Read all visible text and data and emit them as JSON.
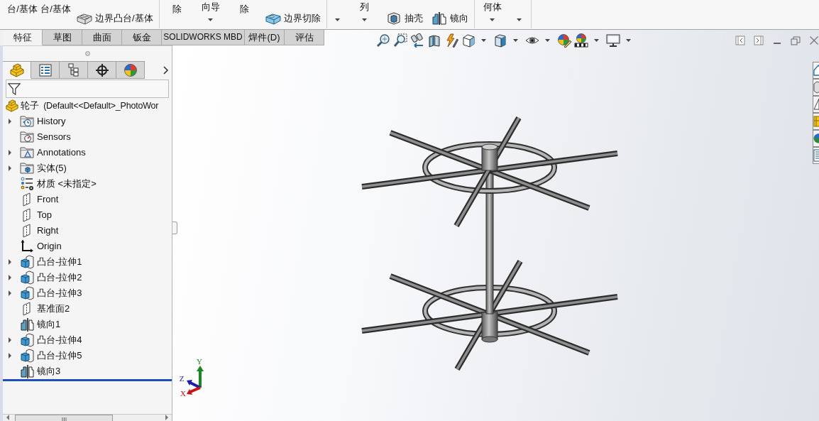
{
  "ribbon": {
    "groups": [
      {
        "items": [
          {
            "kind": "tall",
            "label": "台/基体"
          },
          {
            "kind": "tall",
            "label": "台/基体"
          },
          {
            "kind": "small",
            "label": "边界凸台/基体"
          }
        ]
      },
      {
        "items": [
          {
            "kind": "tall",
            "label": "除"
          },
          {
            "kind": "menu",
            "label": "向导"
          },
          {
            "kind": "tall",
            "label": "除"
          },
          {
            "kind": "small",
            "label": "边界切除"
          }
        ]
      },
      {
        "items": [
          {
            "kind": "caret"
          },
          {
            "kind": "menu",
            "label": "列"
          },
          {
            "kind": "small",
            "label": "抽壳"
          },
          {
            "kind": "small",
            "label": "镜向"
          }
        ]
      },
      {
        "items": [
          {
            "kind": "menu",
            "label": "何体"
          },
          {
            "kind": "caret"
          }
        ]
      }
    ]
  },
  "tabs": [
    {
      "label": "特征",
      "selected": true
    },
    {
      "label": "草图",
      "selected": false
    },
    {
      "label": "曲面",
      "selected": false
    },
    {
      "label": "钣金",
      "selected": false
    },
    {
      "label": "SOLIDWORKS MBD",
      "selected": false
    },
    {
      "label": "焊件(D)",
      "selected": false
    },
    {
      "label": "评估",
      "selected": false
    }
  ],
  "feature_manager": {
    "panel_tabs": [
      {
        "selected": true
      },
      {
        "selected": false
      },
      {
        "selected": false
      },
      {
        "selected": false
      },
      {
        "selected": false
      }
    ],
    "tree": {
      "root": "轮子  (Default<<Default>_PhotoWor",
      "items": [
        {
          "kind": "history",
          "label": "History",
          "expanded": false
        },
        {
          "kind": "sensors",
          "label": "Sensors"
        },
        {
          "kind": "annotations",
          "label": "Annotations",
          "expanded": false
        },
        {
          "kind": "bodies",
          "label": "实体(5)",
          "expanded": false
        },
        {
          "kind": "material",
          "label": "材质 <未指定>"
        },
        {
          "kind": "plane",
          "label": "Front"
        },
        {
          "kind": "plane",
          "label": "Top"
        },
        {
          "kind": "plane",
          "label": "Right"
        },
        {
          "kind": "origin",
          "label": "Origin"
        },
        {
          "kind": "feature",
          "label": "凸台-拉伸1",
          "expanded": false
        },
        {
          "kind": "feature",
          "label": "凸台-拉伸2",
          "expanded": false
        },
        {
          "kind": "feature",
          "label": "凸台-拉伸3",
          "expanded": false
        },
        {
          "kind": "plane",
          "label": "基准面2"
        },
        {
          "kind": "mirror",
          "label": "镜向1"
        },
        {
          "kind": "feature",
          "label": "凸台-拉伸4",
          "expanded": false
        },
        {
          "kind": "feature",
          "label": "凸台-拉伸5",
          "expanded": false
        },
        {
          "kind": "mirror",
          "label": "镜向3"
        }
      ]
    }
  },
  "viewport": {
    "triad": {
      "x_label": "X",
      "y_label": "Y",
      "z_label": "Z"
    }
  }
}
